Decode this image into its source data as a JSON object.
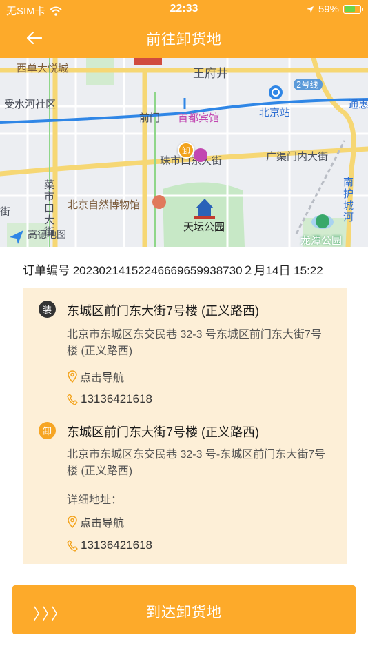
{
  "status": {
    "carrier": "无SIM卡",
    "time": "22:33",
    "battery": "59%"
  },
  "nav": {
    "title": "前往卸货地"
  },
  "map": {
    "labels": {
      "xidan": "西单大悦城",
      "wangfujing": "王府井",
      "shoushuihe": "受水河社区",
      "line2": "2号线",
      "beijingzhan": "北京站",
      "tonghui": "通惠",
      "qianmen": "前门",
      "shoudu": "首都宾馆",
      "zhushikou": "珠市口东大街",
      "guangqumen": "广渠门内大街",
      "caishikou": "菜市口大街",
      "jie": "街",
      "museum": "北京自然博物馆",
      "tiantan": "天坛公园",
      "nanhu": "南护城河",
      "longtan": "龙潭公园",
      "amap": "高德地图"
    },
    "pin_label": "卸"
  },
  "order": {
    "text": "订单编号 20230214152246669659938730２月14日 15:22"
  },
  "load": {
    "badge": "装",
    "name": "东城区前门东大街7号楼 (正义路西)",
    "address": "北京市东城区东交民巷 32-3 号东城区前门东大街7号楼 (正义路西)",
    "nav_label": "点击导航",
    "phone": "13136421618"
  },
  "unload": {
    "badge": "卸",
    "name": "东城区前门东大街7号楼 (正义路西)",
    "address": "北京市东城区东交民巷 32-3 号-东城区前门东大街7号楼 (正义路西)",
    "detail_label": "详细地址：",
    "nav_label": "点击导航",
    "phone": "13136421618"
  },
  "action": {
    "chevrons": "〉〉〉",
    "label": "到达卸货地"
  },
  "colors": {
    "accent": "#fdaa2a",
    "card": "#fdefd7",
    "metro": "#2f86e6",
    "road": "#f6d774"
  }
}
